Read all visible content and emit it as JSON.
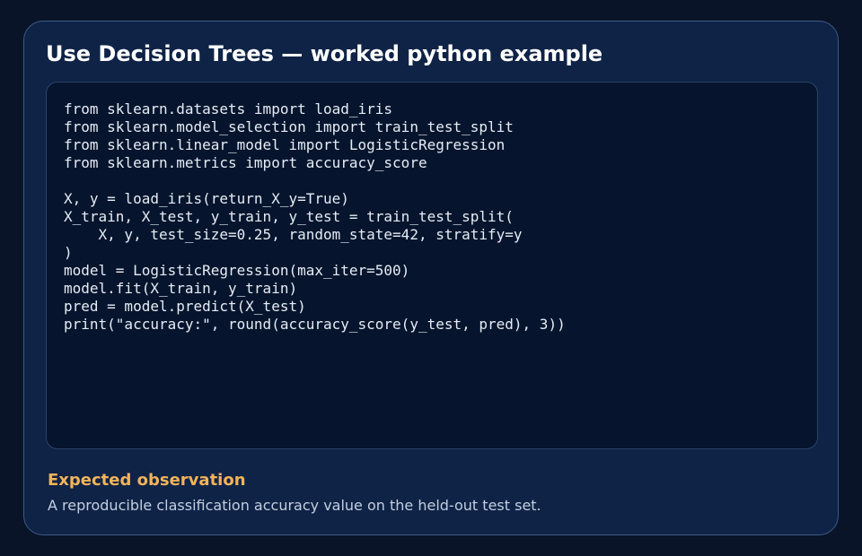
{
  "card": {
    "title": "Use Decision Trees — worked python example"
  },
  "code": {
    "language": "python",
    "lines": [
      "from sklearn.datasets import load_iris",
      "from sklearn.model_selection import train_test_split",
      "from sklearn.linear_model import LogisticRegression",
      "from sklearn.metrics import accuracy_score",
      "",
      "X, y = load_iris(return_X_y=True)",
      "X_train, X_test, y_train, y_test = train_test_split(",
      "    X, y, test_size=0.25, random_state=42, stratify=y",
      ")",
      "model = LogisticRegression(max_iter=500)",
      "model.fit(X_train, y_train)",
      "pred = model.predict(X_test)",
      "print(\"accuracy:\", round(accuracy_score(y_test, pred), 3))"
    ]
  },
  "observation": {
    "heading": "Expected observation",
    "text": "A reproducible classification accuracy value on the held-out test set."
  },
  "colors": {
    "background": "#0a1428",
    "card": "#0e2346",
    "card_border": "#3d5a86",
    "code_background": "#06152d",
    "accent": "#f4b35a"
  }
}
